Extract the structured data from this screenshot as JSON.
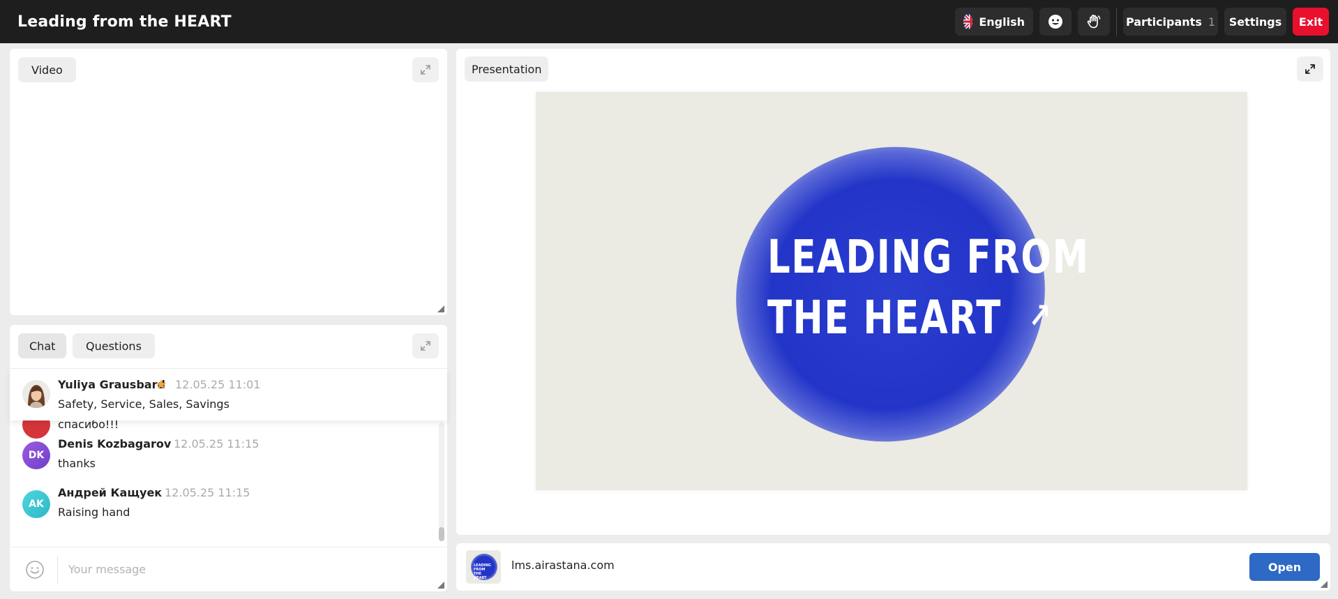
{
  "header": {
    "title": "Leading from the HEART",
    "language_label": "English",
    "participants_label": "Participants",
    "participants_count": "1",
    "settings_label": "Settings",
    "exit_label": "Exit"
  },
  "video": {
    "tab_label": "Video"
  },
  "presentation": {
    "tab_label": "Presentation",
    "slide_line1": "LEADING FROM",
    "slide_line2": "THE HEART",
    "slide_arrow": "↗"
  },
  "chat": {
    "tabs": [
      {
        "label": "Chat"
      },
      {
        "label": "Questions"
      }
    ],
    "pinned": {
      "author": "Yuliya Grausbard",
      "time": "12.05.25 11:01",
      "text": "Safety, Service, Sales, Savings"
    },
    "messages": [
      {
        "author": "",
        "initials": "",
        "time": "",
        "text": "спасибо!!!",
        "color": "#d4353b"
      },
      {
        "author": "Denis Kozbagarov",
        "initials": "DK",
        "time": "12.05.25 11:15",
        "text": "thanks",
        "color": "#8b4fd8"
      },
      {
        "author": "Андрей Кащуек",
        "initials": "AK",
        "time": "12.05.25 11:15",
        "text": "Raising hand",
        "color": "#38c6d4"
      }
    ],
    "input_placeholder": "Your message"
  },
  "link": {
    "thumb_text": "LEADING FROM THE HEART",
    "url": "lms.airastana.com",
    "open_label": "Open"
  },
  "colors": {
    "topbar": "#1e1e1e",
    "exit": "#e8102e",
    "open_button": "#2d69c5",
    "slide_blob": "#2335c8",
    "star": "#f2a33a"
  }
}
